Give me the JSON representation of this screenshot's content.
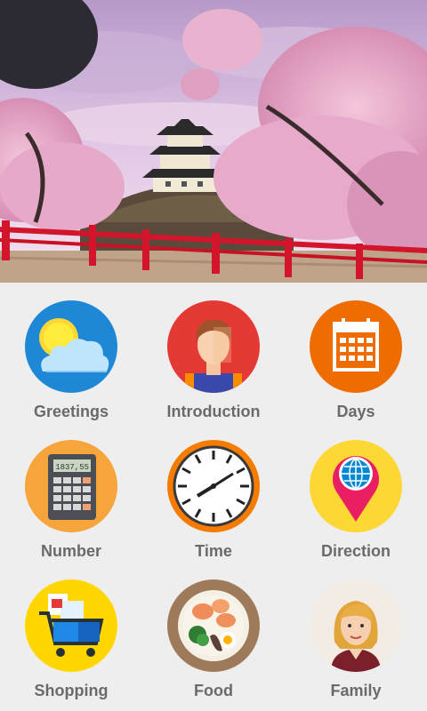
{
  "categories": [
    {
      "label": "Greetings",
      "icon": "weather-icon"
    },
    {
      "label": "Introduction",
      "icon": "person-icon"
    },
    {
      "label": "Days",
      "icon": "calendar-icon"
    },
    {
      "label": "Number",
      "icon": "calculator-icon"
    },
    {
      "label": "Time",
      "icon": "clock-icon"
    },
    {
      "label": "Direction",
      "icon": "map-pin-globe-icon"
    },
    {
      "label": "Shopping",
      "icon": "shopping-cart-icon"
    },
    {
      "label": "Food",
      "icon": "food-bowl-icon"
    },
    {
      "label": "Family",
      "icon": "woman-avatar-icon"
    }
  ],
  "calculator_display": "1837,55",
  "colors": {
    "background": "#eeeeee",
    "label": "#6a6a6a"
  }
}
